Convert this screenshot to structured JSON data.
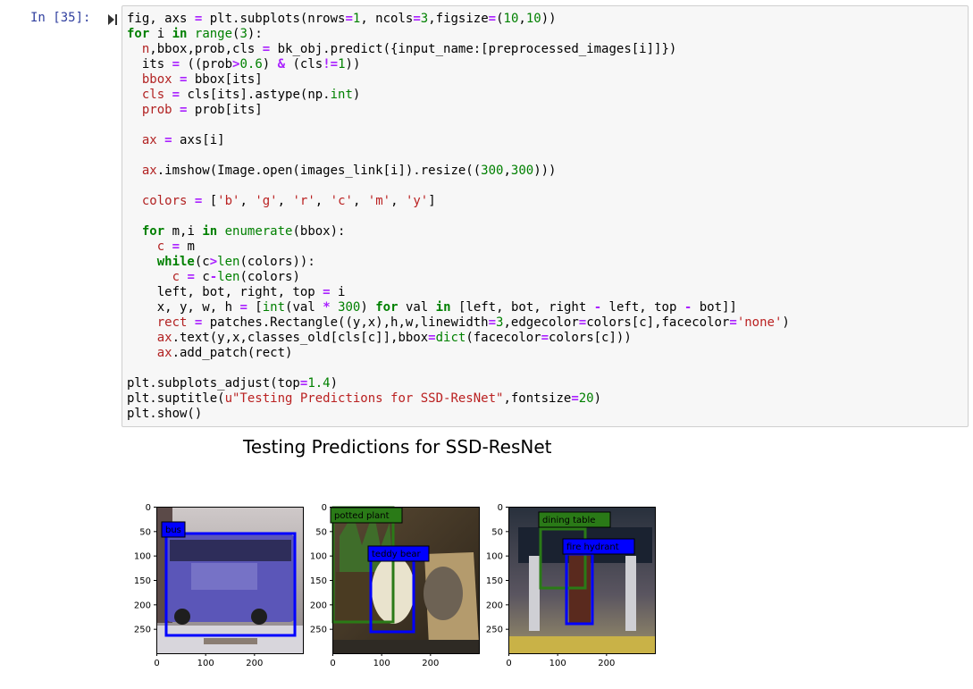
{
  "cell": {
    "prompt": "In [35]:",
    "lines": [
      "fig, axs = plt.subplots(nrows=1, ncols=3,figsize=(10,10))",
      "for i in range(3):",
      "  n,bbox,prob,cls = bk_obj.predict({input_name:[preprocessed_images[i]]})",
      "  its = ((prob>0.6) & (cls!=1))",
      "  bbox = bbox[its]",
      "  cls = cls[its].astype(np.int)",
      "  prob = prob[its]",
      "",
      "  ax = axs[i]",
      "",
      "  ax.imshow(Image.open(images_link[i]).resize((300,300)))",
      "",
      "  colors = ['b', 'g', 'r', 'c', 'm', 'y']",
      "",
      "  for m,i in enumerate(bbox):",
      "    c = m",
      "    while(c>len(colors)):",
      "      c = c-len(colors)",
      "    left, bot, right, top = i",
      "    x, y, w, h = [int(val * 300) for val in [left, bot, right - left, top - bot]]",
      "    rect = patches.Rectangle((y,x),h,w,linewidth=3,edgecolor=colors[c],facecolor='none')",
      "    ax.text(y,x,classes_old[cls[c]],bbox=dict(facecolor=colors[c]))",
      "    ax.add_patch(rect)",
      "",
      "plt.subplots_adjust(top=1.4)",
      "plt.suptitle(u\"Testing Predictions for SSD-ResNet\",fontsize=20)",
      "plt.show()"
    ]
  },
  "output": {
    "suptitle": "Testing Predictions for SSD-ResNet",
    "y_ticks": [
      "0",
      "50",
      "100",
      "150",
      "200",
      "250"
    ],
    "x_ticks": [
      "0",
      "100",
      "200"
    ],
    "panels": [
      {
        "detections": [
          {
            "label": "bus",
            "color": "#0000ff"
          }
        ]
      },
      {
        "detections": [
          {
            "label": "potted plant",
            "color": "#2a7a17"
          },
          {
            "label": "teddy bear",
            "color": "#0000ff"
          }
        ]
      },
      {
        "detections": [
          {
            "label": "dining table",
            "color": "#2a7a17"
          },
          {
            "label": "fire hydrant",
            "color": "#0000ff"
          }
        ]
      }
    ]
  },
  "colors": {
    "prompt": "#303f9f",
    "keyword": "#008000",
    "operator": "#aa22ff",
    "string": "#ba2121",
    "variable": "#b22222",
    "cell_bg": "#f7f7f7"
  }
}
